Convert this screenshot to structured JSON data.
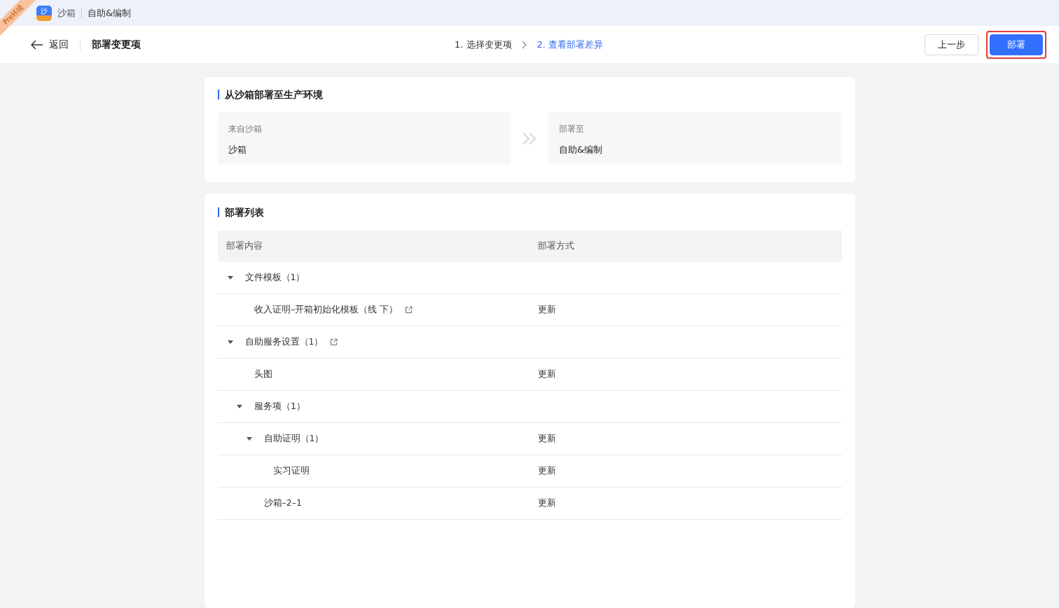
{
  "app_bar": {
    "logo": "沙",
    "env": "沙箱",
    "workspace": "自助&编制"
  },
  "env_ribbon": "Pre环境",
  "header": {
    "back": "返回",
    "title": "部署变更项",
    "steps": [
      {
        "label": "1. 选择变更项",
        "selected": false
      },
      {
        "label": "2. 查看部署差异",
        "selected": true
      }
    ],
    "buttons": [
      {
        "label": "上一步",
        "kind": "secondary",
        "highlighted": false
      },
      {
        "label": "部署",
        "kind": "primary",
        "highlighted": true
      }
    ]
  },
  "source_section": {
    "title": "从沙箱部署至生产环境",
    "from": {
      "label": "来自沙箱",
      "value": "沙箱"
    },
    "to": {
      "label": "部署至",
      "value": "自助&编制"
    }
  },
  "deploy_list": {
    "title": "部署列表",
    "columns": [
      "部署内容",
      "部署方式"
    ],
    "rows": [
      {
        "label": "文件模板（1）",
        "expanded": true,
        "children": [
          {
            "label": "收入证明–开箱初始化模板（线 下）",
            "link": true,
            "method": "更新"
          }
        ]
      },
      {
        "label": "自助服务设置（1）",
        "link": true,
        "expanded": true,
        "children": [
          {
            "label": "头图",
            "method": "更新"
          },
          {
            "label": "服务项（1）",
            "expanded": true,
            "children": [
              {
                "label": "自助证明（1）",
                "method": "更新",
                "expanded": true,
                "children": [
                  {
                    "label": "实习证明",
                    "method": "更新"
                  }
                ]
              },
              {
                "label": "沙箱–2–1",
                "method": "更新"
              }
            ]
          }
        ]
      }
    ]
  }
}
